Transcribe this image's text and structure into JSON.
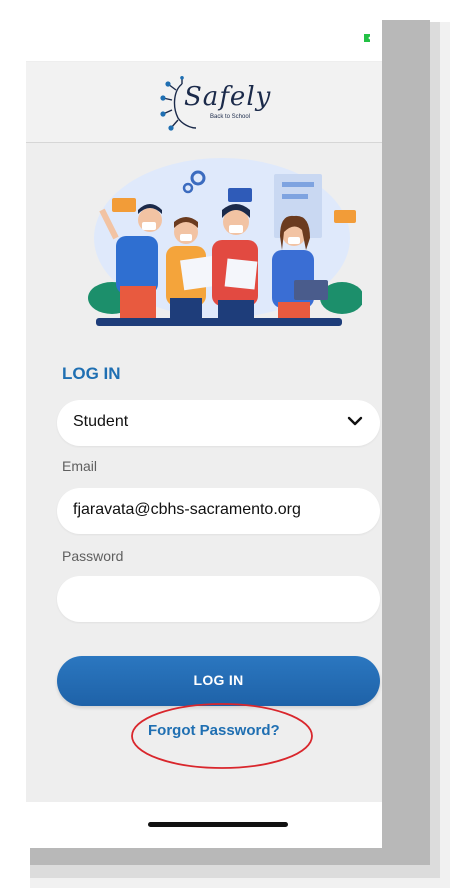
{
  "app": {
    "logo_text": "Safely",
    "logo_subtitle": "Back to School"
  },
  "login": {
    "heading": "LOG IN",
    "role_select_value": "Student",
    "email_label": "Email",
    "email_value": "fjaravata@cbhs-sacramento.org",
    "password_label": "Password",
    "password_value": "",
    "submit_label": "LOG IN",
    "forgot_password_label": "Forgot Password?"
  },
  "icons": {
    "battery": "battery-icon",
    "chevron": "chevron-down-icon"
  },
  "colors": {
    "accent": "#1f6fb2",
    "button_top": "#2b77c0",
    "button_bottom": "#1e62a8",
    "annotation": "#d9262c",
    "battery": "#23c145"
  }
}
